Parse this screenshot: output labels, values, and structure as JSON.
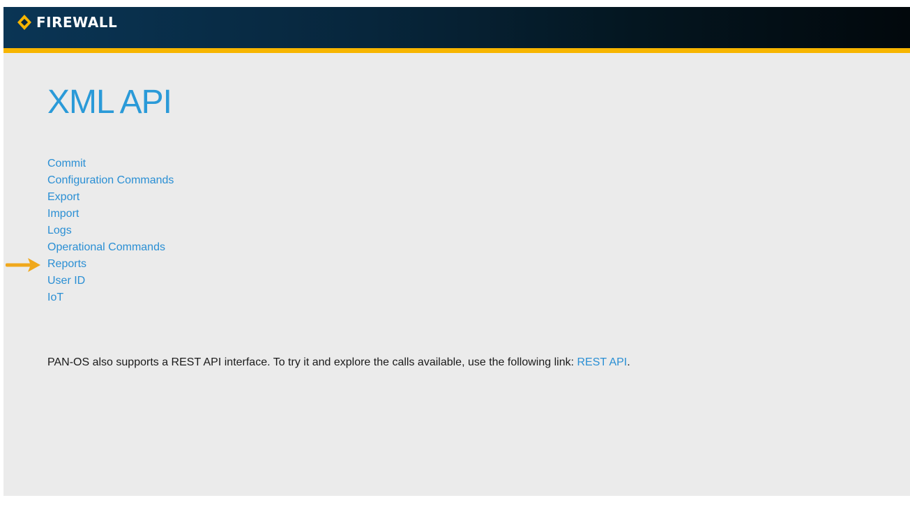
{
  "header": {
    "brand": "FIREWALL",
    "logo_icon": "firewall-logo-icon",
    "accent_color": "#f7b500"
  },
  "main": {
    "title": "XML API",
    "links": [
      {
        "label": "Commit"
      },
      {
        "label": "Configuration Commands"
      },
      {
        "label": "Export"
      },
      {
        "label": "Import"
      },
      {
        "label": "Logs"
      },
      {
        "label": "Operational Commands"
      },
      {
        "label": "Reports"
      },
      {
        "label": "User ID"
      },
      {
        "label": "IoT"
      }
    ],
    "highlight_arrow": {
      "icon": "arrow-right-icon",
      "points_to": "Reports",
      "color": "#f0a81c"
    }
  },
  "footer": {
    "text": "PAN-OS also supports a REST API interface. To try it and explore the calls available, use the following link: ",
    "link_label": "REST API",
    "suffix": "."
  },
  "colors": {
    "background": "#ebebeb",
    "link": "#2a8fd4",
    "title": "#2a9ad8",
    "header": "#07263c"
  }
}
